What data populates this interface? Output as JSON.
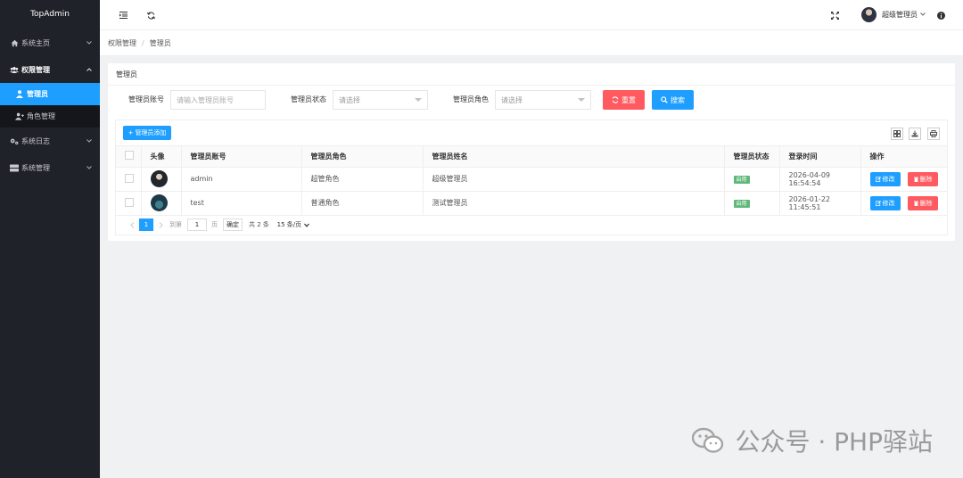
{
  "app": {
    "title": "TopAdmin"
  },
  "sidebar": {
    "items": [
      {
        "label": "系统主页",
        "icon": "home-icon"
      },
      {
        "label": "权限管理",
        "icon": "users-icon",
        "open": true,
        "children": [
          {
            "label": "管理员",
            "icon": "user-icon",
            "active": true
          },
          {
            "label": "角色管理",
            "icon": "user-plus-icon"
          }
        ]
      },
      {
        "label": "系统日志",
        "icon": "cogs-icon"
      },
      {
        "label": "系统管理",
        "icon": "server-icon"
      }
    ]
  },
  "header": {
    "user_name": "超级管理员"
  },
  "breadcrumb": {
    "level1": "权限管理",
    "separator": "/",
    "level2": "管理员"
  },
  "card": {
    "title": "管理员"
  },
  "search": {
    "account_label": "管理员账号",
    "account_placeholder": "请输入管理员账号",
    "status_label": "管理员状态",
    "status_placeholder": "请选择",
    "role_label": "管理员角色",
    "role_placeholder": "请选择",
    "reset_label": "重置",
    "search_label": "搜索"
  },
  "toolbar": {
    "add_label": "管理员添加"
  },
  "table": {
    "headers": [
      "头像",
      "管理员账号",
      "管理员角色",
      "管理员姓名",
      "管理员状态",
      "登录时间",
      "操作"
    ],
    "rows": [
      {
        "account": "admin",
        "role": "超管角色",
        "name": "超级管理员",
        "status": "启用",
        "login_time": "2026-04-09 16:54:54"
      },
      {
        "account": "test",
        "role": "普通角色",
        "name": "测试管理员",
        "status": "启用",
        "login_time": "2026-01-22 11:45:51"
      }
    ],
    "edit_label": "修改",
    "delete_label": "删除"
  },
  "pagination": {
    "current_page": "1",
    "goto_label": "到第",
    "page_input": "1",
    "page_unit": "页",
    "confirm_label": "确定",
    "total_label": "共 2 条",
    "page_size": "15 条/页"
  },
  "watermark": {
    "text": "公众号 · PHP驿站"
  },
  "colors": {
    "sidebar_bg": "#20222a",
    "active_blue": "#1e9fff",
    "danger_red": "#ff5a5f",
    "success_green": "#5fb878"
  }
}
